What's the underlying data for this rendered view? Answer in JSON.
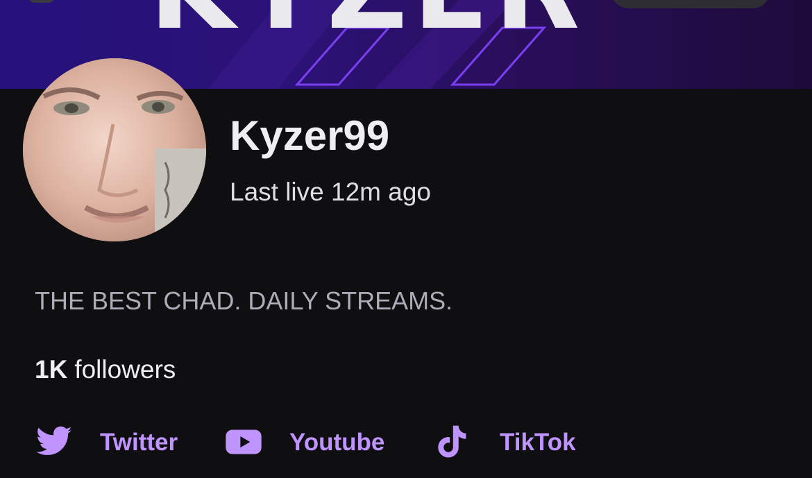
{
  "banner": {
    "text": "KYZER",
    "colors": {
      "start": "#25127a",
      "end": "#1e0b3a",
      "outline": "#7b3ff2"
    }
  },
  "profile": {
    "name": "Kyzer99",
    "last_live": "Last live 12m ago",
    "bio": "THE BEST CHAD. DAILY STREAMS.",
    "followers_count": "1K",
    "followers_label": "followers",
    "avatar_icon": "profile-photo"
  },
  "socials": [
    {
      "label": "Twitter",
      "icon": "twitter-bird-icon"
    },
    {
      "label": "Youtube",
      "icon": "youtube-play-icon"
    },
    {
      "label": "TikTok",
      "icon": "tiktok-note-icon"
    }
  ],
  "colors": {
    "background": "#0f0e11",
    "text_primary": "#efeff1",
    "text_secondary": "#adadb8",
    "accent": "#bf94ff"
  }
}
